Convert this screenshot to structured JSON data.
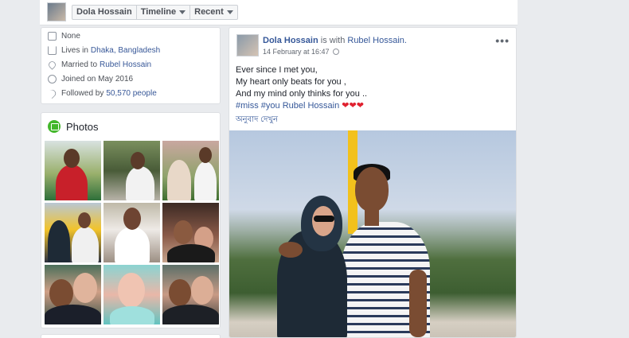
{
  "topbar": {
    "profile_name": "Dola Hossain",
    "tab_timeline": "Timeline",
    "tab_recent": "Recent"
  },
  "intro": {
    "items": [
      {
        "icon": "briefcase-icon",
        "text": "None",
        "link": ""
      },
      {
        "icon": "home-icon",
        "text": "Lives in",
        "link": "Dhaka, Bangladesh"
      },
      {
        "icon": "heart-icon",
        "text": "Married to",
        "link": "Rubel Hossain"
      },
      {
        "icon": "clock-icon",
        "text": "Joined on May 2016",
        "link": ""
      },
      {
        "icon": "rss-icon",
        "text": "Followed by",
        "link": "50,570 people"
      }
    ]
  },
  "photos": {
    "title": "Photos",
    "count": 9
  },
  "post": {
    "author": "Dola Hossain",
    "with_text": "is with",
    "tagged": "Rubel Hossain.",
    "timestamp": "14 February at 16:47",
    "more": "•••",
    "lines": [
      "Ever since I met you,",
      "My heart only beats for you ,",
      "And my mind only thinks for you .."
    ],
    "hashtags": "#miss #you Rubel Hossain",
    "hearts": "❤❤❤",
    "translate": "অনুবাদ দেখুন"
  },
  "colors": {
    "link": "#385898",
    "background": "#e9ebee",
    "photos_icon": "#42b72a"
  }
}
